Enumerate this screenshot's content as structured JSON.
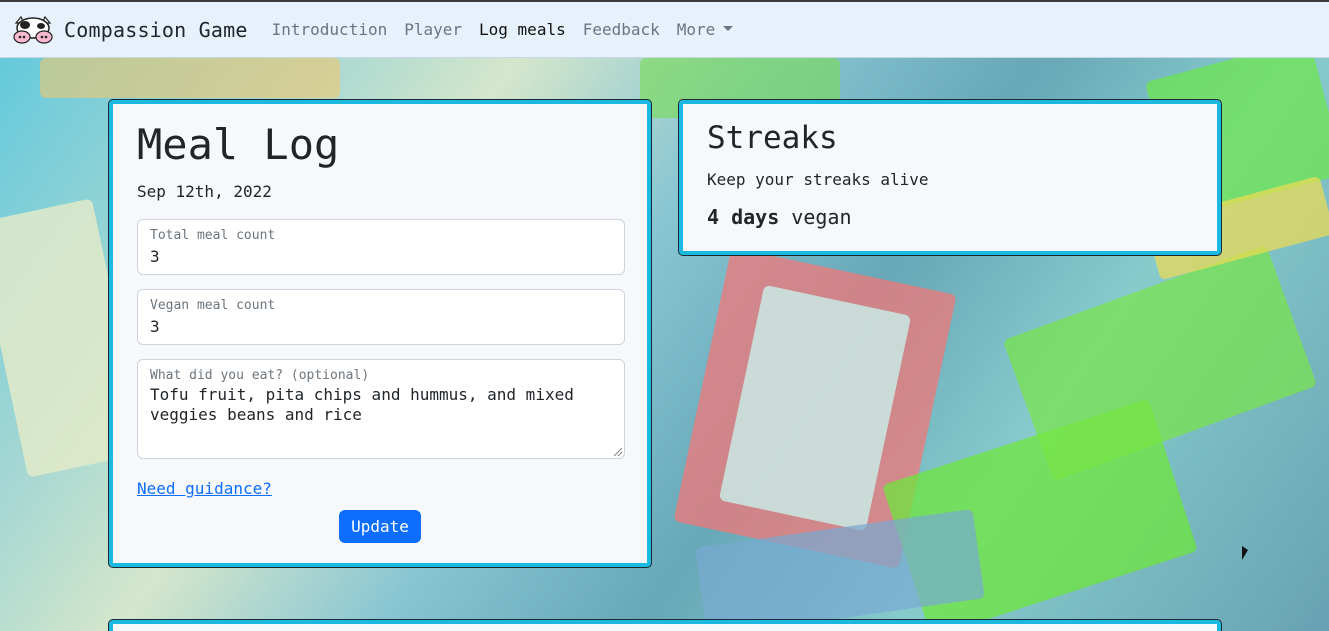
{
  "navbar": {
    "brand": "Compassion Game",
    "logo_icon": "cow-icon",
    "links": [
      {
        "label": "Introduction",
        "active": false
      },
      {
        "label": "Player",
        "active": false
      },
      {
        "label": "Log meals",
        "active": true
      },
      {
        "label": "Feedback",
        "active": false
      },
      {
        "label": "More",
        "active": false
      }
    ]
  },
  "meal_log": {
    "title": "Meal Log",
    "date": "Sep 12th, 2022",
    "total_meal": {
      "label": "Total meal count",
      "value": "3"
    },
    "vegan_meal": {
      "label": "Vegan meal count",
      "value": "3"
    },
    "what_eat": {
      "label": "What did you eat? (optional)",
      "value": "Tofu fruit, pita chips and hummus, and mixed veggies beans and rice"
    },
    "guidance_link": "Need guidance?",
    "update_button": "Update"
  },
  "streaks": {
    "title": "Streaks",
    "subtitle": "Keep your streaks alive",
    "streak_days": "4 days",
    "streak_type": "vegan"
  },
  "colors": {
    "card_border": "#1bb9e0",
    "primary": "#0d6efd",
    "navbar_bg": "#e6f1fc"
  }
}
